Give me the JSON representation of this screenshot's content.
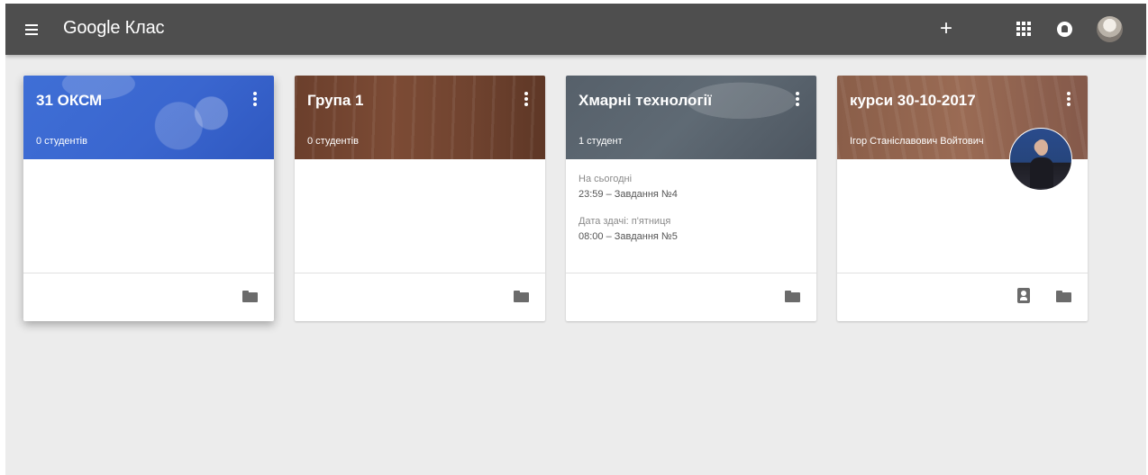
{
  "app": {
    "title": "Google Клас"
  },
  "topbar": {
    "icons": [
      "menu-icon",
      "plus-icon",
      "apps-grid-icon",
      "notifications-icon",
      "account-avatar"
    ],
    "add_label": "+"
  },
  "colors": {
    "topbar": "#4e4e4e",
    "page_background": "#ececec",
    "class_blue": "#3a66cf",
    "class_brown": "#7c4b35",
    "class_slate": "#5f6a74",
    "class_sand": "#9a6b54"
  },
  "classes": [
    {
      "title": "31 ОКСМ",
      "subtitle": "0 студентів",
      "footer_icons": [
        "folder-icon"
      ]
    },
    {
      "title": "Група 1",
      "subtitle": "0 студентів",
      "footer_icons": [
        "folder-icon"
      ]
    },
    {
      "title": "Хмарні технології",
      "subtitle": "1 студент",
      "due": [
        {
          "label": "На сьогодні",
          "item": "23:59 – Завдання №4"
        },
        {
          "label": "Дата здачі: п'ятниця",
          "item": "08:00 – Завдання №5"
        }
      ],
      "footer_icons": [
        "folder-icon"
      ]
    },
    {
      "title": "курси 30-10-2017",
      "subtitle": "Ігор Станіславович Войтович",
      "footer_icons": [
        "gradebook-icon",
        "folder-icon"
      ]
    }
  ]
}
